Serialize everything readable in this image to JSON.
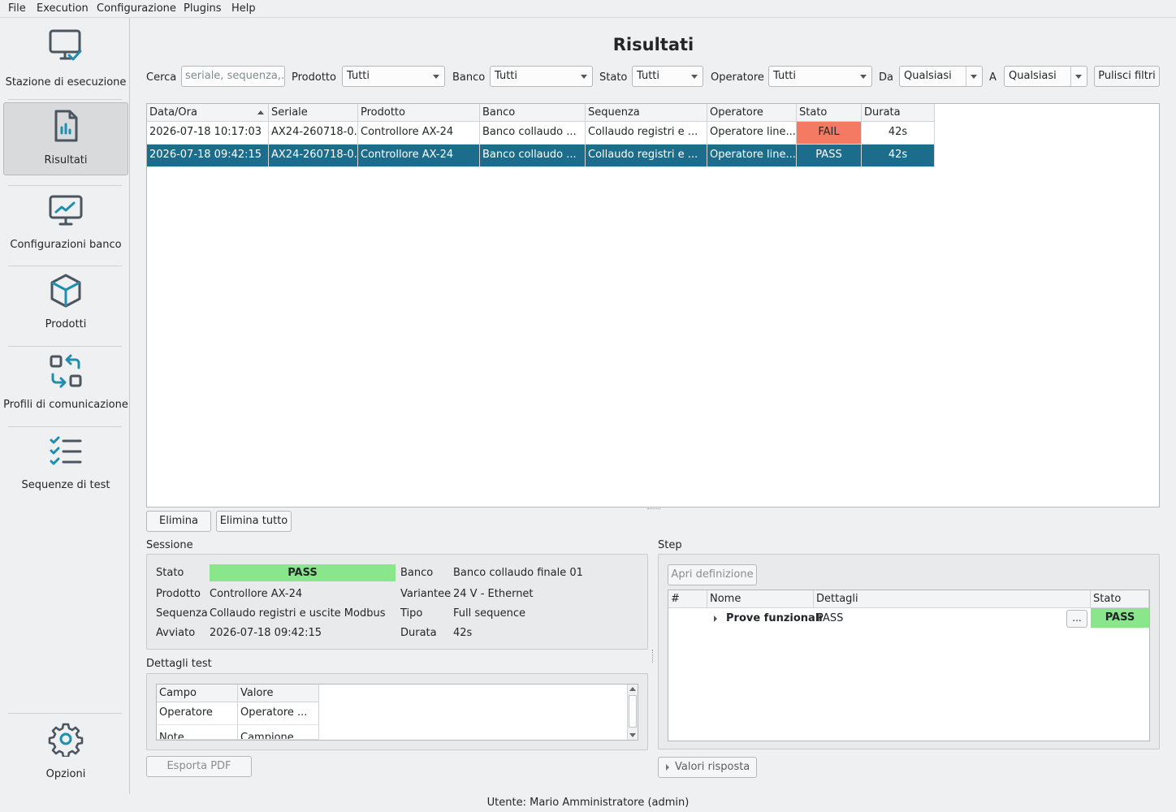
{
  "menu": {
    "file": "File",
    "execution": "Execution",
    "configurazione": "Configurazione",
    "plugins": "Plugins",
    "help": "Help"
  },
  "sidebar": {
    "items": [
      {
        "label": "Stazione di esecuzione",
        "icon": "monitor-check-icon"
      },
      {
        "label": "Risultati",
        "icon": "report-chart-icon"
      },
      {
        "label": "Configurazioni banco",
        "icon": "monitor-chart-icon"
      },
      {
        "label": "Prodotti",
        "icon": "cube-icon"
      },
      {
        "label": "Profili di comunicazione",
        "icon": "swap-icon"
      },
      {
        "label": "Sequenze di test",
        "icon": "checklist-icon"
      }
    ],
    "options": {
      "label": "Opzioni",
      "icon": "gear-icon"
    }
  },
  "page": {
    "title": "Risultati"
  },
  "filters": {
    "search_label": "Cerca",
    "search_placeholder": "seriale, sequenza,...",
    "product_label": "Prodotto",
    "product_value": "Tutti",
    "bench_label": "Banco",
    "bench_value": "Tutti",
    "state_label": "Stato",
    "state_value": "Tutti",
    "operator_label": "Operatore",
    "operator_value": "Tutti",
    "from_label": "Da",
    "from_value": "Qualsiasi",
    "to_label": "A",
    "to_value": "Qualsiasi",
    "clear_button": "Pulisci filtri"
  },
  "results": {
    "columns": [
      "Data/Ora",
      "Seriale",
      "Prodotto",
      "Banco",
      "Sequenza",
      "Operatore",
      "Stato",
      "Durata"
    ],
    "rows": [
      {
        "datetime": "2026-07-18 10:17:03",
        "serial": "AX24-260718-0...",
        "product": "Controllore AX-24",
        "bench": "Banco collaudo ...",
        "sequence": "Collaudo registri e ...",
        "operator": "Operatore line...",
        "state": "FAIL",
        "duration": "42s"
      },
      {
        "datetime": "2026-07-18 09:42:15",
        "serial": "AX24-260718-0...",
        "product": "Controllore AX-24",
        "bench": "Banco collaudo ...",
        "sequence": "Collaudo registri e ...",
        "operator": "Operatore line...",
        "state": "PASS",
        "duration": "42s"
      }
    ]
  },
  "actions": {
    "delete": "Elimina",
    "delete_all": "Elimina tutto"
  },
  "session": {
    "title": "Sessione",
    "state_label": "Stato",
    "state_value": "PASS",
    "product_label": "Prodotto",
    "product_value": "Controllore AX-24",
    "sequence_label": "Sequenza",
    "sequence_value": "Collaudo registri e uscite Modbus",
    "started_label": "Avviato",
    "started_value": "2026-07-18 09:42:15",
    "bench_label": "Banco",
    "bench_value": "Banco collaudo finale 01",
    "variant_label": "Variantee",
    "variant_value": "24 V - Ethernet",
    "type_label": "Tipo",
    "type_value": "Full sequence",
    "duration_label": "Durata",
    "duration_value": "42s"
  },
  "test_details": {
    "title": "Dettagli test",
    "columns": [
      "Campo",
      "Valore"
    ],
    "rows": [
      {
        "field": "Operatore",
        "value": "Operatore ..."
      },
      {
        "field": "Note",
        "value": "Campione"
      }
    ],
    "export_button": "Esporta PDF"
  },
  "steps": {
    "title": "Step",
    "open_definition": "Apri definizione",
    "columns": [
      "#",
      "Nome",
      "Dettagli",
      "Stato"
    ],
    "rows": [
      {
        "name": "Prove funzionali",
        "details": "PASS",
        "more": "...",
        "state": "PASS"
      }
    ],
    "response_values": "Valori risposta"
  },
  "status": {
    "user": "Utente: Mario Amministratore (admin)"
  },
  "colors": {
    "selection": "#1c6d8c",
    "pass": "#8ae68a",
    "fail": "#f47a64",
    "icon_accent": "#1f8fb0",
    "icon_dark": "#4a5560"
  }
}
